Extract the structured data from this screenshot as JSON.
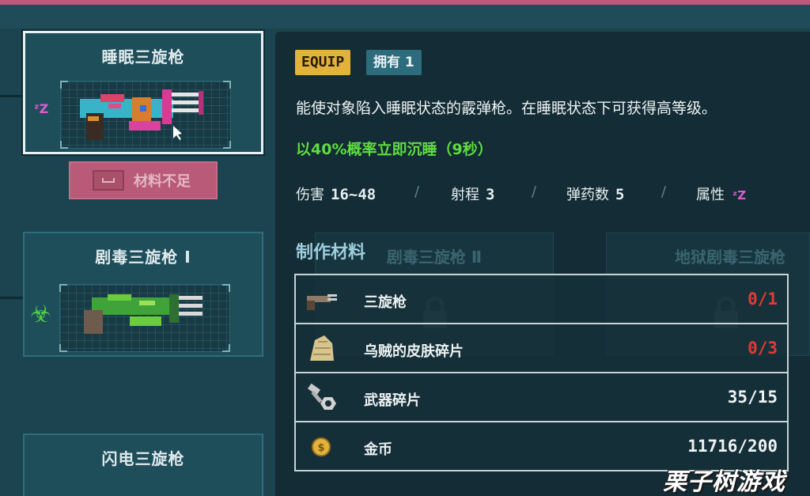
{
  "weapons": [
    {
      "name": "睡眠三旋枪",
      "selected": true,
      "side_icon": "sleep-zzz-icon"
    },
    {
      "name": "剧毒三旋枪 Ⅰ",
      "selected": false,
      "side_icon": "biohazard-icon"
    },
    {
      "name": "闪电三旋枪",
      "selected": false
    }
  ],
  "craft_button": {
    "label": "材料不足",
    "key_icon": "spacebar-key-icon"
  },
  "locked_cards": [
    {
      "name": "剧毒三旋枪 Ⅱ"
    },
    {
      "name": "地狱剧毒三旋枪"
    }
  ],
  "detail": {
    "equip_tag": "EQUIP",
    "owned_tag": "拥有 1",
    "description": "能使对象陷入睡眠状态的霰弹枪。在睡眠状态下可获得高等级。",
    "effect": "以40%概率立即沉睡（9秒）",
    "stats": [
      {
        "label": "伤害",
        "value": "16~48"
      },
      {
        "label": "射程",
        "value": "3"
      },
      {
        "label": "弹药数",
        "value": "5"
      },
      {
        "label": "属性",
        "icon": "sleep-zzz-icon"
      }
    ],
    "separator": "/",
    "materials_title": "制作材料",
    "materials": [
      {
        "name": "三旋枪",
        "count": "0/1",
        "status": "short",
        "icon": "shotgun-icon"
      },
      {
        "name": "乌贼的皮肤碎片",
        "count": "0/3",
        "status": "short",
        "icon": "squid-skin-icon"
      },
      {
        "name": "武器碎片",
        "count": "35/15",
        "status": "ok",
        "icon": "bolt-nut-icon"
      },
      {
        "name": "金币",
        "count": "11716/200",
        "status": "ok",
        "icon": "gold-coin-icon"
      }
    ]
  },
  "watermark": "栗子树游戏",
  "colors": {
    "background": "#1b4450",
    "panel": "#132c35",
    "equip_tag": "#e3b23c",
    "effect_green": "#5fdc3f",
    "shortage_red": "#e23b33",
    "button_pink": "#b95b78"
  }
}
